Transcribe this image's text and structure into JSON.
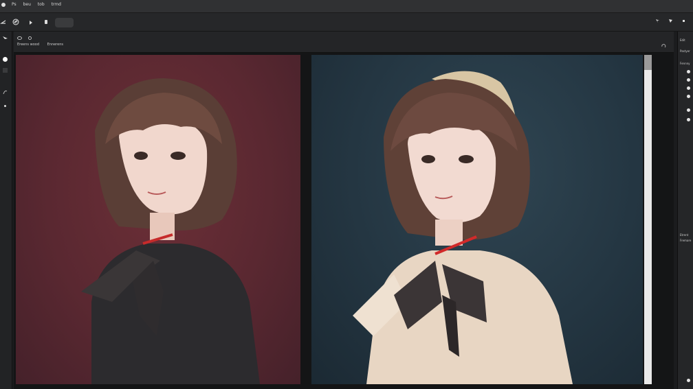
{
  "menubar": {
    "items": [
      "Ps",
      "beu",
      "tob",
      "trmd"
    ]
  },
  "document": {
    "tabs": [
      "Ereens wood",
      "Ennerens"
    ]
  },
  "right_panel": {
    "labels": [
      "Edit",
      "Pastyer",
      "Fennny",
      "Etrent",
      "Fremare"
    ]
  },
  "colors": {
    "left_background": "#5a2831",
    "right_background": "#243642",
    "chrome": "#262729"
  },
  "icons": {
    "app": "app-icon",
    "move": "move-tool-icon",
    "brush": "brush-icon",
    "hand": "hand-icon",
    "eye": "eye-icon",
    "lock": "lock-icon"
  }
}
